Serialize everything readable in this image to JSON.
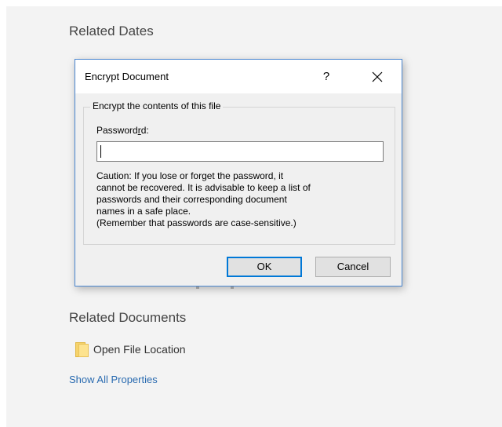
{
  "backstage": {
    "related_dates_heading": "Related Dates",
    "related_documents_heading": "Related Documents",
    "open_file_location": "Open File Location",
    "show_all_properties": "Show All Properties"
  },
  "dialog": {
    "title": "Encrypt Document",
    "help_label": "?",
    "group_label": "Encrypt the contents of this file",
    "password_label_before": "Password",
    "password_label_mnemonic": "r",
    "password_label_after": "d:",
    "password_value": "",
    "caution_lines": [
      "Caution: If you lose or forget the password, it",
      "cannot be recovered. It is advisable to keep a list of",
      "passwords and their corresponding document",
      "names in a safe place.",
      "(Remember that passwords are case-sensitive.)"
    ],
    "ok_label": "OK",
    "cancel_label": "Cancel"
  },
  "icons": {
    "close": "close-icon",
    "folder": "folder-icon"
  },
  "colors": {
    "dialog_border": "#4a86d0",
    "default_button_border": "#0078d7",
    "link": "#2a6bb0",
    "backstage_bg": "#f3f3f3"
  }
}
